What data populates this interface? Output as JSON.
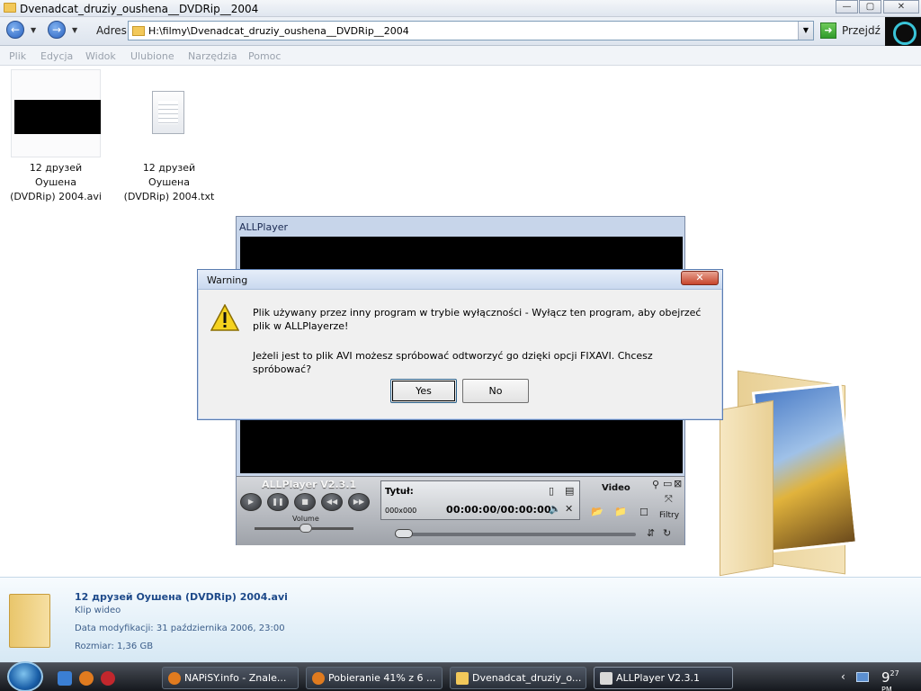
{
  "window": {
    "title": "Dvenadcat_druziy_oushena__DVDRip__2004",
    "controls": [
      "—",
      "▢",
      "✕"
    ]
  },
  "address_bar": {
    "label": "Adres",
    "path": "H:\\filmy\\Dvenadcat_druziy_oushena__DVDRip__2004",
    "go_label": "Przejdź"
  },
  "menu": [
    "Plik",
    "Edycja",
    "Widok",
    "Ulubione",
    "Narzędzia",
    "Pomoc"
  ],
  "files": [
    {
      "name_line1": "12 друзей Оушена",
      "name_line2": "(DVDRip) 2004.avi"
    },
    {
      "name_line1": "12 друзей Оушена",
      "name_line2": "(DVDRip) 2004.txt"
    }
  ],
  "player": {
    "window_title": "ALLPlayer",
    "name": "ALLPlayer V2.3.1",
    "volume_label": "Volume",
    "title_label": "Tytuł:",
    "resolution": "000x000",
    "time": "00:00:00/00:00:00",
    "video_label": "Video",
    "filters_label": "Filtry"
  },
  "dialog": {
    "title": "Warning",
    "close": "✕",
    "message1": "Plik używany przez inny program w trybie wyłączności - Wyłącz ten program, aby obejrzeć plik w ALLPlayerze!",
    "message2": "Jeżeli jest to plik AVI możesz spróbować odtworzyć go dzięki opcji FIXAVI. Chcesz spróbować?",
    "yes_label": "Yes",
    "no_label": "No"
  },
  "details": {
    "name": "12 друзей Оушена (DVDRip) 2004.avi",
    "type": "Klip wideo",
    "modified": "Data modyfikacji: 31 października 2006, 23:00",
    "size": "Rozmiar: 1,36 GB"
  },
  "taskbar": {
    "tasks": [
      "NAPiSY.info - Znale...",
      "Pobieranie 41% z 6 ...",
      "Dvenadcat_druziy_o...",
      "ALLPlayer V2.3.1"
    ],
    "clock_time": "9",
    "clock_min": "27",
    "clock_ampm": "PM"
  },
  "colors": {
    "dialog_title_bg": "#c9d9ef",
    "close_red": "#c7452c",
    "details_text": "#1e4a8a"
  }
}
